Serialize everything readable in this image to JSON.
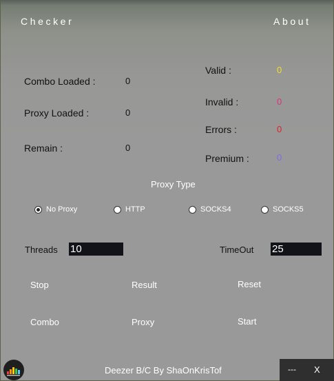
{
  "nav": {
    "checker": "Checker",
    "about": "About"
  },
  "stats_left": [
    {
      "label": "Combo Loaded :",
      "value": "0"
    },
    {
      "label": "Proxy Loaded :",
      "value": "0"
    },
    {
      "label": "Remain :",
      "value": "0"
    }
  ],
  "stats_right": [
    {
      "label": "Valid :",
      "value": "0",
      "color": "#f0e02a"
    },
    {
      "label": "Invalid :",
      "value": "0",
      "color": "#e0307a"
    },
    {
      "label": "Errors :",
      "value": "0",
      "color": "#e01f2a"
    },
    {
      "label": "Premium :",
      "value": "0",
      "color": "#7a6ee0"
    }
  ],
  "proxy_type": {
    "heading": "Proxy Type",
    "options": [
      "No Proxy",
      "HTTP",
      "SOCKS4",
      "SOCKS5"
    ],
    "selected": "No Proxy"
  },
  "threads": {
    "label": "Threads",
    "value": "10"
  },
  "timeout": {
    "label": "TimeOut",
    "value": "25"
  },
  "buttons": {
    "stop": "Stop",
    "result": "Result",
    "reset": "Reset",
    "combo": "Combo",
    "proxy": "Proxy",
    "start": "Start"
  },
  "footer": {
    "credit": "Deezer B/C By ShaOnKrisTof",
    "minimize": "---",
    "close": "X"
  },
  "icons": {
    "logo": "deezer-equalizer-logo"
  }
}
